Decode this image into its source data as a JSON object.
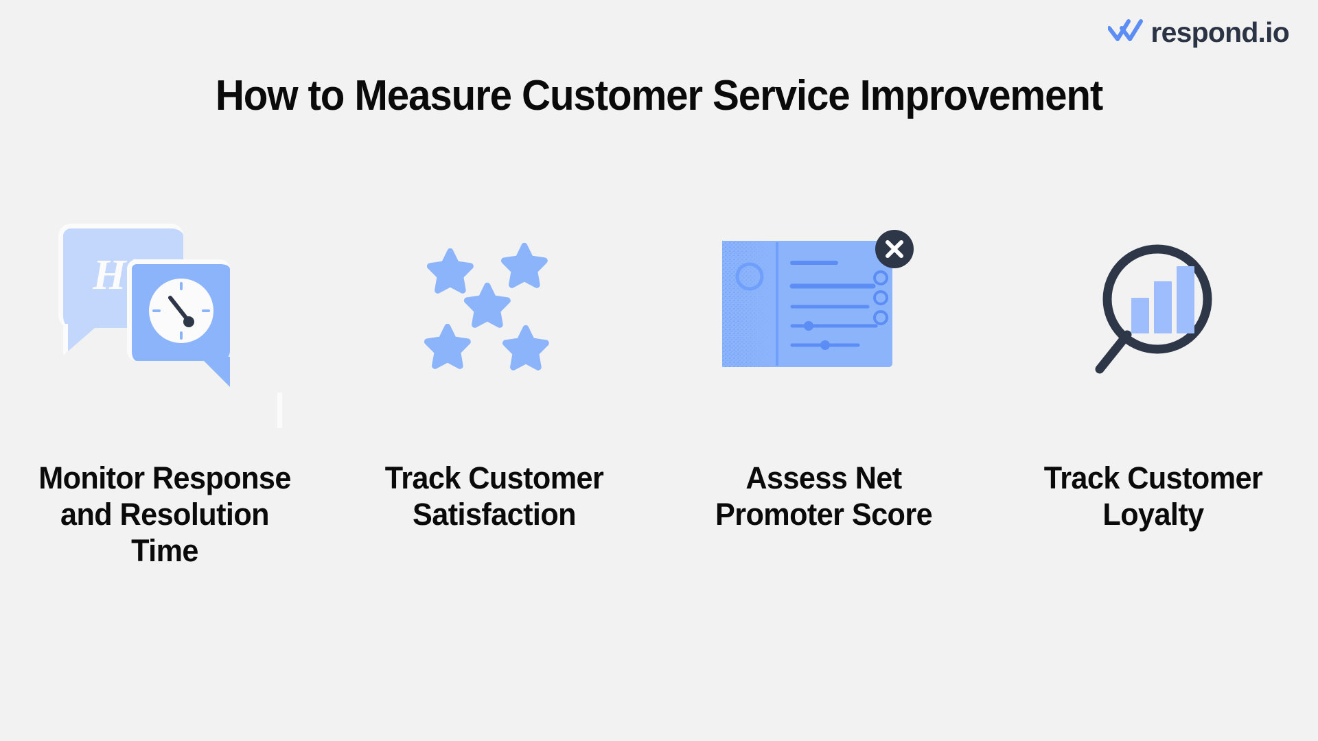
{
  "brand": {
    "name": "respond.io",
    "logo_icon": "double-check-icon",
    "logo_color": "#5b8df5",
    "text_color": "#2b3445"
  },
  "header": {
    "title": "How to Measure Customer Service Improvement"
  },
  "theme": {
    "background": "#f2f2f2",
    "text": "#0a0a0a",
    "blue_light": "#c3d6fb",
    "blue_mid": "#8cb4fb",
    "blue_accent": "#5b8df5",
    "navy": "#2d3748",
    "white": "#fbfbfb"
  },
  "steps": [
    {
      "caption": "Monitor Response and Resolution Time",
      "icon": "chat-bubbles-clock-icon",
      "bubble_text": "Hi!"
    },
    {
      "caption": "Track Customer Satisfaction",
      "icon": "five-stars-icon",
      "star_count": 5
    },
    {
      "caption": "Assess Net Promoter Score",
      "icon": "survey-card-icon",
      "badge_icon": "close-x-icon"
    },
    {
      "caption": "Track Customer Loyalty",
      "icon": "magnifier-bar-chart-icon",
      "bar_count": 3
    }
  ]
}
